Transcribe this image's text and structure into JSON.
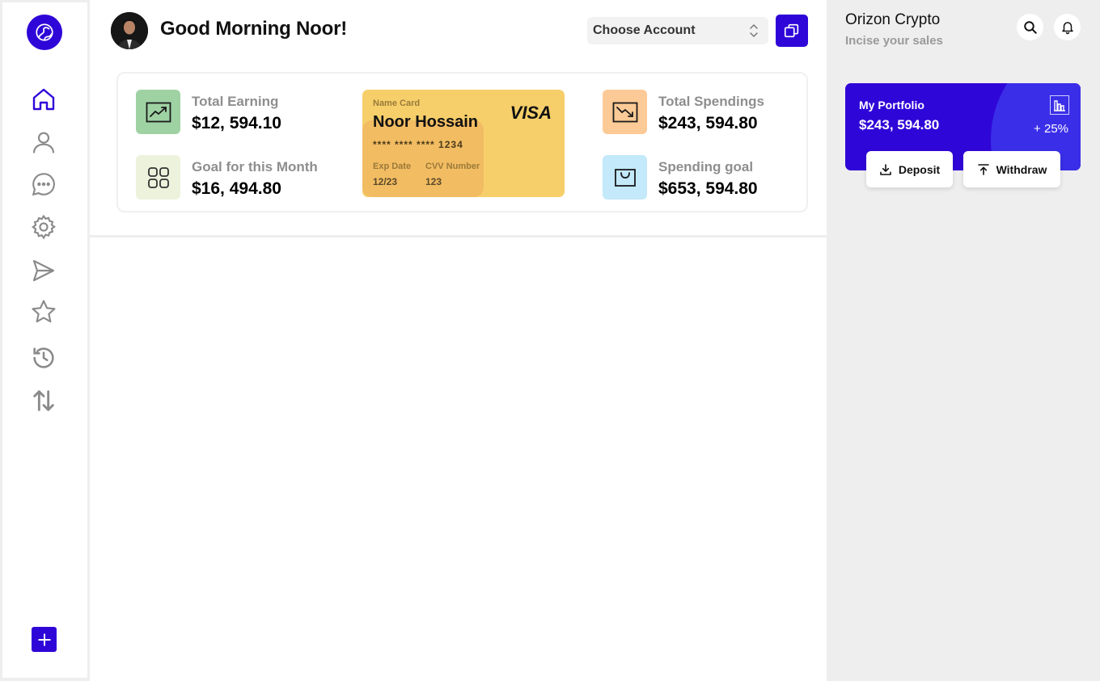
{
  "sidebar": {
    "logo_icon": "globe-icon",
    "nav": [
      {
        "icon": "home-icon",
        "active": true
      },
      {
        "icon": "user-icon"
      },
      {
        "icon": "chat-icon"
      },
      {
        "icon": "settings-icon"
      },
      {
        "icon": "send-icon"
      },
      {
        "icon": "star-icon"
      },
      {
        "icon": "history-icon"
      },
      {
        "icon": "transfer-icon"
      }
    ],
    "add_icon": "plus-icon"
  },
  "header": {
    "greeting": "Good Morning Noor!",
    "account_select": "Choose Account",
    "copy_icon": "copy-icon"
  },
  "stats": {
    "total_earning": {
      "label": "Total Earning",
      "value": "$12, 594.10",
      "icon": "trend-up-icon",
      "color": "#9fd2a3"
    },
    "goal_month": {
      "label": "Goal for this Month",
      "value": "$16, 494.80",
      "icon": "grid-icon",
      "color": "#edf2dc"
    },
    "total_spendings": {
      "label": "Total Spendings",
      "value": "$243, 594.80",
      "icon": "trend-down-icon",
      "color": "#fcca96"
    },
    "spending_goal": {
      "label": "Spending goal",
      "value": "$653, 594.80",
      "icon": "bag-icon",
      "color": "#c3e9fa"
    }
  },
  "card": {
    "name_label": "Name Card",
    "holder": "Noor Hossain",
    "brand": "VISA",
    "number": "**** **** **** 1234",
    "exp_label": "Exp Date",
    "exp_value": "12/23",
    "cvv_label": "CVV Number",
    "cvv_value": "123"
  },
  "right": {
    "brand": "Orizon Crypto",
    "subtitle": "Incise your sales",
    "search_icon": "search-icon",
    "bell_icon": "bell-icon",
    "portfolio": {
      "label": "My Portfolio",
      "value": "$243, 594.80",
      "change": "+ 25%",
      "chart_icon": "bar-chart-icon"
    },
    "deposit": "Deposit",
    "withdraw": "Withdraw"
  },
  "colors": {
    "accent": "#2f06d8",
    "card": "#f6cf6a"
  }
}
